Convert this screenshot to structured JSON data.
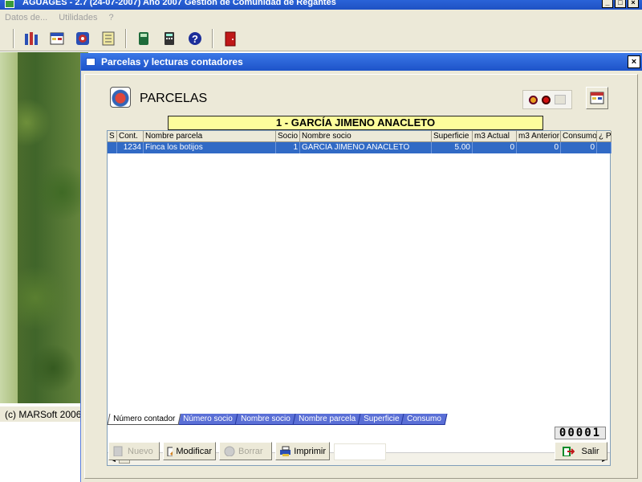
{
  "main_window": {
    "title": "AGUAGES - 2.7  (24-07-2007) Año 2007 Gestión de Comunidad de Regantes",
    "menu": [
      "Datos de...",
      "Utilidades",
      "?"
    ],
    "controls": {
      "minimize": "_",
      "maximize": "□",
      "close": "×"
    },
    "toolbar_icons": [
      "people-icon",
      "grid-icon",
      "meter-icon",
      "ledger-icon",
      "calculator-green-icon",
      "calculator-icon",
      "help-icon",
      "exit-door-icon"
    ],
    "status_text": "(c) MARSoft 2006-"
  },
  "dialog": {
    "title": "Parcelas y lecturas contadores",
    "close": "×",
    "section_title": "PARCELAS",
    "banner": "1 - GARCÍA JIMENO ANACLETO",
    "grid": {
      "columns": [
        "S",
        "Cont.",
        "Nombre parcela",
        "Socio",
        "Nombre socio",
        "Superficie",
        "m3 Actual",
        "m3 Anterior",
        "Consumo",
        "¿ P"
      ],
      "rows": [
        {
          "s": "",
          "cont": "1234",
          "parcela": "Finca los botijos",
          "socio": "1",
          "nombre_socio": "GARCIA JIMENO ANACLETO",
          "superficie": "5.00",
          "m3_actual": "0",
          "m3_anterior": "0",
          "consumo": "0",
          "p": ""
        }
      ]
    },
    "tabs": [
      "Número contador",
      "Número socio",
      "Nombre socio",
      "Nombre parcela",
      "Superficie",
      "Consumo"
    ],
    "active_tab": 0,
    "counter": "00001",
    "buttons": {
      "nuevo": "Nuevo",
      "modificar": "Modificar",
      "borrar": "Borrar",
      "imprimir": "Imprimir",
      "salir": "Salir"
    },
    "colors": {
      "selection": "#316ac5",
      "banner": "#fdfd9c",
      "titlebar": "#1d53c9"
    }
  }
}
